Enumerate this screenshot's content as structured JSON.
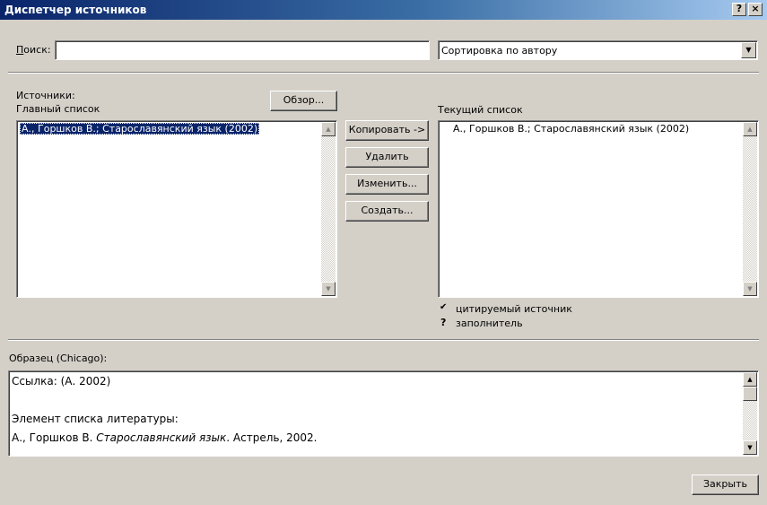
{
  "window": {
    "title": "Диспетчер источников",
    "help_label": "?",
    "close_label": "×"
  },
  "search": {
    "label_hot": "П",
    "label_rest": "оиск:",
    "value": "",
    "placeholder": ""
  },
  "sort": {
    "selected": "Сортировка по автору"
  },
  "sources": {
    "label": "Источники:",
    "browse_label": "Обзор...",
    "master_list_label": "Главный список",
    "master_items": [
      "А., Горшков В.; Старославянский язык (2002)"
    ]
  },
  "actions": {
    "copy": "Копировать ->",
    "delete": "Удалить",
    "edit": "Изменить...",
    "create": "Создать..."
  },
  "current": {
    "label": "Текущий список",
    "items": [
      "А., Горшков В.; Старославянский язык (2002)"
    ]
  },
  "legend": {
    "cited_symbol": "✔",
    "cited_label": "цитируемый источник",
    "placeholder_symbol": "?",
    "placeholder_label": "заполнитель"
  },
  "preview": {
    "label": "Образец (Chicago):",
    "citation": "Ссылка: (А. 2002)",
    "bib_heading": "Элемент списка литературы:",
    "bib_author": "А., Горшков В. ",
    "bib_title": "Старославянский язык",
    "bib_rest": ". Астрель, 2002."
  },
  "footer": {
    "close_button": "Закрыть"
  }
}
